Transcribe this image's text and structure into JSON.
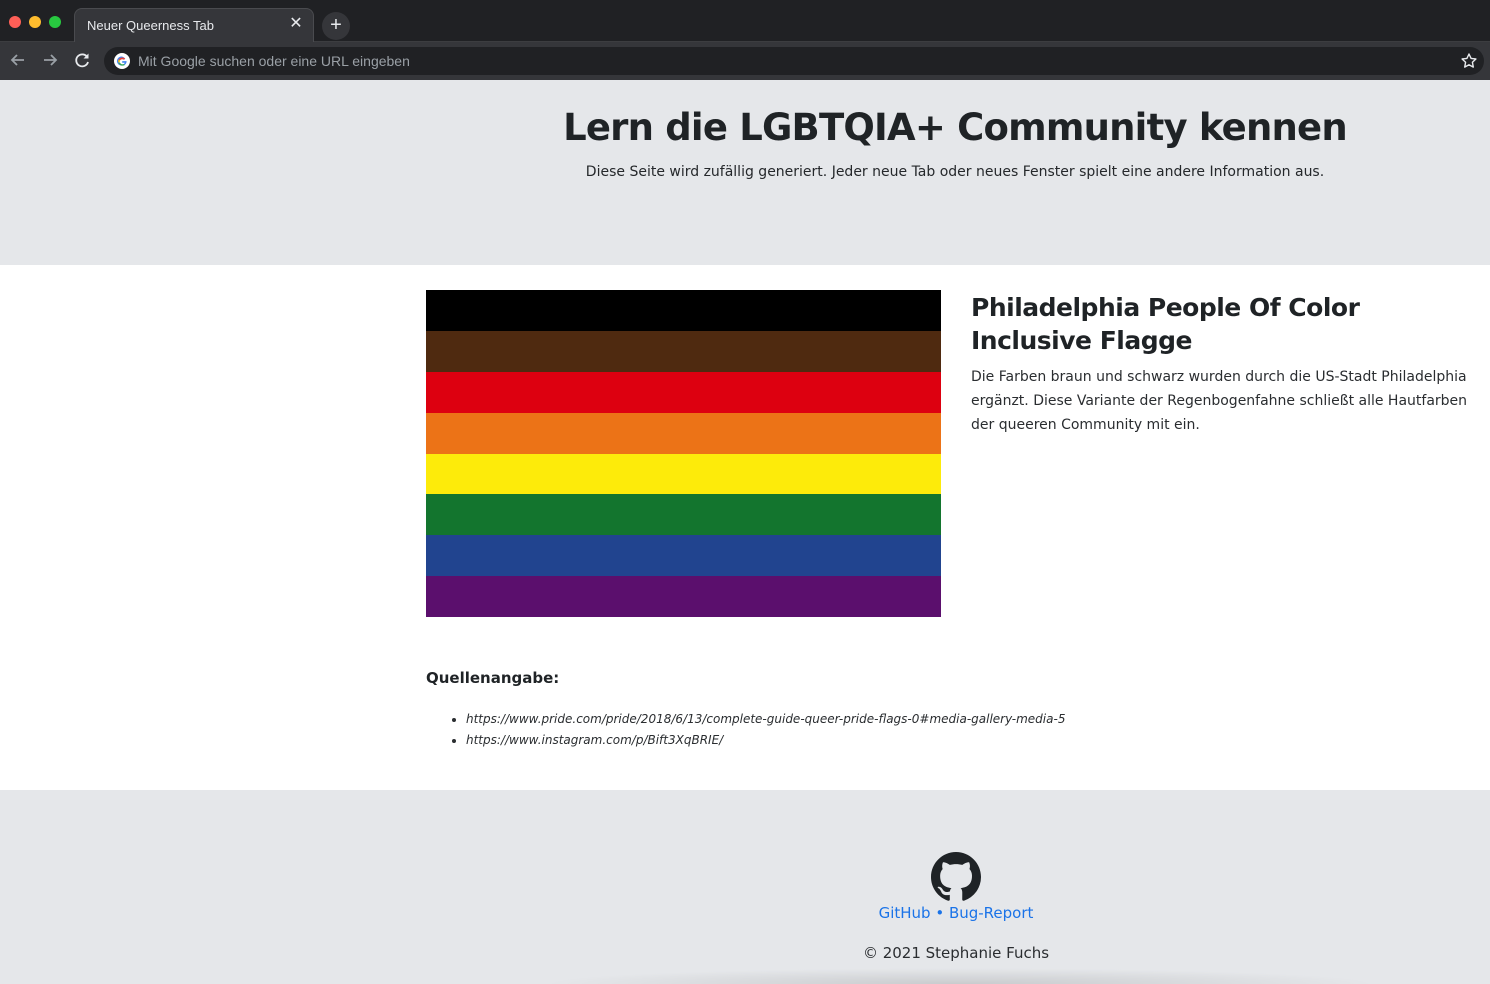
{
  "browser": {
    "tab_title": "Neuer Queerness Tab",
    "tab_close": "✕",
    "new_tab": "+",
    "omnibox_placeholder": "Mit Google suchen oder eine URL eingeben"
  },
  "hero": {
    "title": "Lern die LGBTQIA+ Community kennen",
    "subtitle": "Diese Seite wird zufällig generiert. Jeder neue Tab oder neues Fenster spielt eine andere Information aus."
  },
  "flag": {
    "stripes": [
      "#000000",
      "#4f2a10",
      "#dd0010",
      "#ec7317",
      "#fdeb0a",
      "#13752e",
      "#21448f",
      "#5b0f6d"
    ]
  },
  "info": {
    "title": "Philadelphia People Of Color Inclusive Flagge",
    "description": "Die Farben braun und schwarz wurden durch die US-Stadt Philadelphia ergänzt. Diese Variante der Regenbogenfahne schließt alle Hautfarben der queeren Community mit ein."
  },
  "sources": {
    "label": "Quellenangabe:",
    "items": [
      "https://www.pride.com/pride/2018/6/13/complete-guide-queer-pride-flags-0#media-gallery-media-5",
      "https://www.instagram.com/p/Bift3XqBRIE/"
    ]
  },
  "footer": {
    "github_label": "GitHub",
    "separator": " • ",
    "bug_report_label": "Bug-Report",
    "copyright": "© 2021 Stephanie Fuchs"
  }
}
